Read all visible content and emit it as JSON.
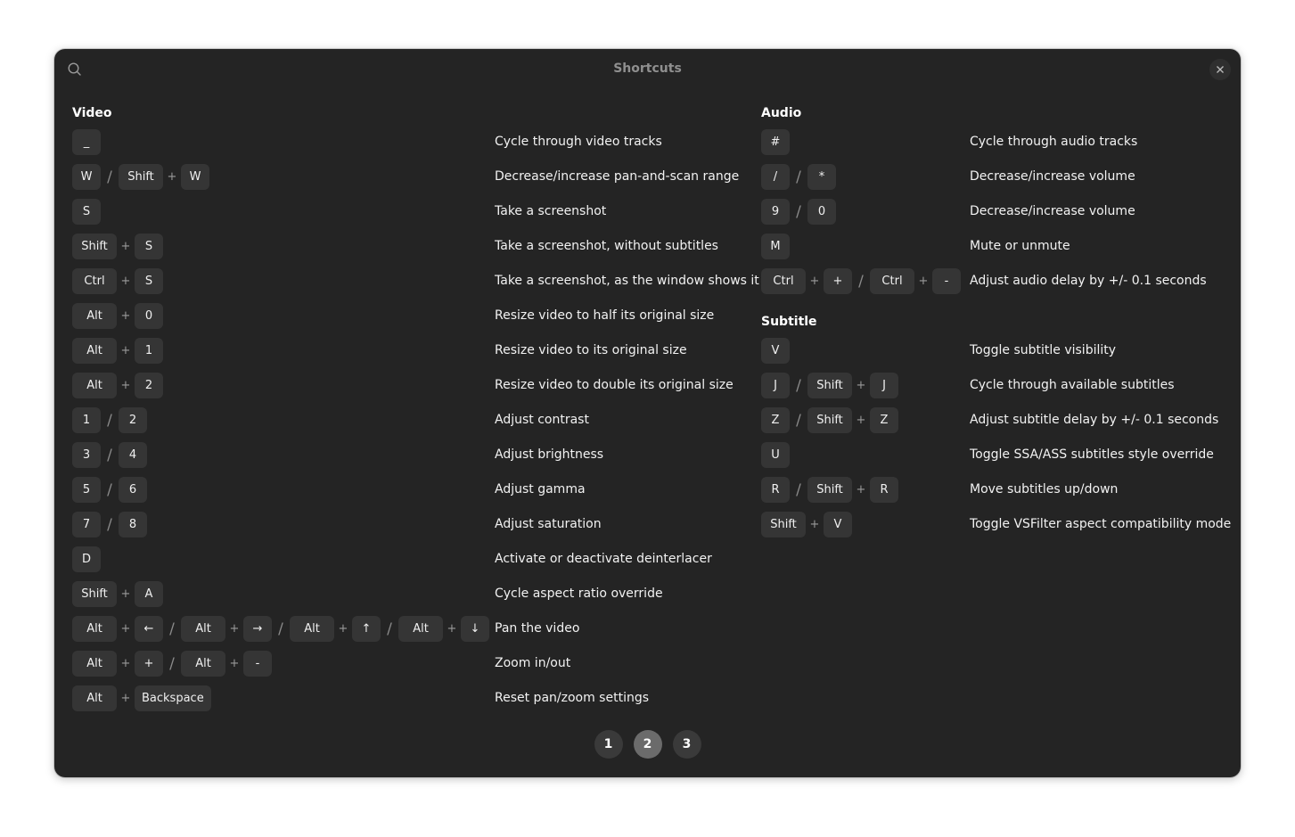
{
  "window": {
    "title": "Shortcuts",
    "search_icon": "search-icon",
    "close_icon": "close-icon"
  },
  "sections": {
    "video": {
      "title": "Video",
      "rows": [
        {
          "keys": [
            "_"
          ],
          "seps": [],
          "desc": "Cycle through video tracks"
        },
        {
          "keys": [
            "W",
            "Shift",
            "W"
          ],
          "seps": [
            "/",
            "+"
          ],
          "desc": "Decrease/increase pan-and-scan range"
        },
        {
          "keys": [
            "S"
          ],
          "seps": [],
          "desc": "Take a screenshot"
        },
        {
          "keys": [
            "Shift",
            "S"
          ],
          "seps": [
            "+"
          ],
          "desc": "Take a screenshot, without subtitles"
        },
        {
          "keys": [
            "Ctrl",
            "S"
          ],
          "seps": [
            "+"
          ],
          "desc": "Take a screenshot, as the window shows it"
        },
        {
          "keys": [
            "Alt",
            "0"
          ],
          "seps": [
            "+"
          ],
          "desc": "Resize video to half its original size"
        },
        {
          "keys": [
            "Alt",
            "1"
          ],
          "seps": [
            "+"
          ],
          "desc": "Resize video to its original size"
        },
        {
          "keys": [
            "Alt",
            "2"
          ],
          "seps": [
            "+"
          ],
          "desc": "Resize video to double its original size"
        },
        {
          "keys": [
            "1",
            "2"
          ],
          "seps": [
            "/"
          ],
          "desc": "Adjust contrast"
        },
        {
          "keys": [
            "3",
            "4"
          ],
          "seps": [
            "/"
          ],
          "desc": "Adjust brightness"
        },
        {
          "keys": [
            "5",
            "6"
          ],
          "seps": [
            "/"
          ],
          "desc": "Adjust gamma"
        },
        {
          "keys": [
            "7",
            "8"
          ],
          "seps": [
            "/"
          ],
          "desc": "Adjust saturation"
        },
        {
          "keys": [
            "D"
          ],
          "seps": [],
          "desc": "Activate or deactivate deinterlacer"
        },
        {
          "keys": [
            "Shift",
            "A"
          ],
          "seps": [
            "+"
          ],
          "desc": "Cycle aspect ratio override"
        },
        {
          "keys": [
            "Alt",
            "←",
            "Alt",
            "→",
            "Alt",
            "↑",
            "Alt",
            "↓"
          ],
          "seps": [
            "+",
            "/",
            "+",
            "/",
            "+",
            "/",
            "+"
          ],
          "desc": "Pan the video"
        },
        {
          "keys": [
            "Alt",
            "+",
            "Alt",
            "-"
          ],
          "seps": [
            "+",
            "/",
            "+"
          ],
          "desc": "Zoom in/out"
        },
        {
          "keys": [
            "Alt",
            "Backspace"
          ],
          "seps": [
            "+"
          ],
          "desc": "Reset pan/zoom settings"
        }
      ]
    },
    "audio": {
      "title": "Audio",
      "rows": [
        {
          "keys": [
            "#"
          ],
          "seps": [],
          "desc": "Cycle through audio tracks"
        },
        {
          "keys": [
            "/",
            "*"
          ],
          "seps": [
            "/"
          ],
          "desc": "Decrease/increase volume"
        },
        {
          "keys": [
            "9",
            "0"
          ],
          "seps": [
            "/"
          ],
          "desc": "Decrease/increase volume"
        },
        {
          "keys": [
            "M"
          ],
          "seps": [],
          "desc": "Mute or unmute"
        },
        {
          "keys": [
            "Ctrl",
            "+",
            "Ctrl",
            "-"
          ],
          "seps": [
            "+",
            "/",
            "+"
          ],
          "desc": "Adjust audio delay by +/- 0.1 seconds"
        }
      ]
    },
    "subtitle": {
      "title": "Subtitle",
      "rows": [
        {
          "keys": [
            "V"
          ],
          "seps": [],
          "desc": "Toggle subtitle visibility"
        },
        {
          "keys": [
            "J",
            "Shift",
            "J"
          ],
          "seps": [
            "/",
            "+"
          ],
          "desc": "Cycle through available subtitles"
        },
        {
          "keys": [
            "Z",
            "Shift",
            "Z"
          ],
          "seps": [
            "/",
            "+"
          ],
          "desc": "Adjust subtitle delay by +/- 0.1 seconds"
        },
        {
          "keys": [
            "U"
          ],
          "seps": [],
          "desc": "Toggle SSA/ASS subtitles style override"
        },
        {
          "keys": [
            "R",
            "Shift",
            "R"
          ],
          "seps": [
            "/",
            "+"
          ],
          "desc": "Move subtitles up/down"
        },
        {
          "keys": [
            "Shift",
            "V"
          ],
          "seps": [
            "+"
          ],
          "desc": "Toggle VSFilter aspect compatibility mode"
        }
      ]
    }
  },
  "pager": {
    "pages": [
      "1",
      "2",
      "3"
    ],
    "current": "2"
  }
}
